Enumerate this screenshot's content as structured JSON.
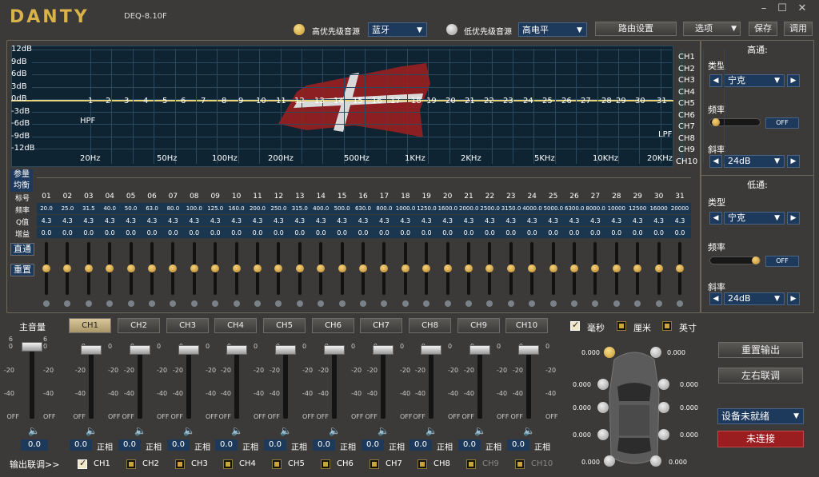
{
  "app": {
    "brand": "DANTY",
    "model": "DEQ-8.10F"
  },
  "window": {
    "min": "–",
    "max": "☐",
    "close": "✕"
  },
  "top": {
    "hi_label": "高优先级音源",
    "hi_value": "蓝牙",
    "lo_label": "低优先级音源",
    "lo_value": "高电平",
    "route_label": "路由设置",
    "options_label": "选项",
    "save_label": "保存",
    "load_label": "调用"
  },
  "graph": {
    "ylabels": [
      "12dB",
      "9dB",
      "6dB",
      "3dB",
      "0dB",
      "-3dB",
      "-6dB",
      "-9dB",
      "-12dB"
    ],
    "flabels": [
      "20Hz",
      "50Hz",
      "100Hz",
      "200Hz",
      "500Hz",
      "1KHz",
      "2KHz",
      "5KHz",
      "10KHz",
      "20KHz"
    ],
    "band_numbers": [
      "1",
      "2",
      "3",
      "4",
      "5",
      "6",
      "7",
      "8",
      "9",
      "10",
      "11",
      "12",
      "13",
      "14",
      "15",
      "16",
      "17",
      "18",
      "19",
      "20",
      "21",
      "22",
      "23",
      "24",
      "25",
      "26",
      "27",
      "28",
      "29",
      "30",
      "31"
    ],
    "hpf": "HPF",
    "lpf": "LPF",
    "channels": [
      "CH1",
      "CH2",
      "CH3",
      "CH4",
      "CH5",
      "CH6",
      "CH7",
      "CH8",
      "CH9",
      "CH10"
    ],
    "colors": {
      "bg": "#0e2433",
      "grid": "#2c4a5e",
      "curve": "#e8d27a"
    }
  },
  "eq": {
    "tab_param": "参量",
    "tab_graphic": "均衡",
    "row_labels": {
      "band": "标号",
      "freq": "频率",
      "q": "Q值",
      "gain": "增益"
    },
    "bypass": "直通",
    "reset": "重置",
    "bands": [
      "01",
      "02",
      "03",
      "04",
      "05",
      "06",
      "07",
      "08",
      "09",
      "10",
      "11",
      "12",
      "13",
      "14",
      "15",
      "16",
      "17",
      "18",
      "19",
      "20",
      "21",
      "22",
      "23",
      "24",
      "25",
      "26",
      "27",
      "28",
      "29",
      "30",
      "31"
    ],
    "freqs": [
      "20.0",
      "25.0",
      "31.5",
      "40.0",
      "50.0",
      "63.0",
      "80.0",
      "100.0",
      "125.0",
      "160.0",
      "200.0",
      "250.0",
      "315.0",
      "400.0",
      "500.0",
      "630.0",
      "800.0",
      "1000.0",
      "1250.0",
      "1600.0",
      "2000.0",
      "2500.0",
      "3150.0",
      "4000.0",
      "5000.0",
      "6300.0",
      "8000.0",
      "10000",
      "12500",
      "16000",
      "20000"
    ],
    "q": [
      "4.3",
      "4.3",
      "4.3",
      "4.3",
      "4.3",
      "4.3",
      "4.3",
      "4.3",
      "4.3",
      "4.3",
      "4.3",
      "4.3",
      "4.3",
      "4.3",
      "4.3",
      "4.3",
      "4.3",
      "4.3",
      "4.3",
      "4.3",
      "4.3",
      "4.3",
      "4.3",
      "4.3",
      "4.3",
      "4.3",
      "4.3",
      "4.3",
      "4.3",
      "4.3",
      "4.3"
    ],
    "gain": [
      "0.0",
      "0.0",
      "0.0",
      "0.0",
      "0.0",
      "0.0",
      "0.0",
      "0.0",
      "0.0",
      "0.0",
      "0.0",
      "0.0",
      "0.0",
      "0.0",
      "0.0",
      "0.0",
      "0.0",
      "0.0",
      "0.0",
      "0.0",
      "0.0",
      "0.0",
      "0.0",
      "0.0",
      "0.0",
      "0.0",
      "0.0",
      "0.0",
      "0.0",
      "0.0",
      "0.0"
    ]
  },
  "highpass": {
    "title": "高通:",
    "type_label": "类型",
    "type_value": "宁克",
    "freq_label": "频率",
    "freq_btn": "OFF",
    "slope_label": "斜率",
    "slope_value": "24dB",
    "freq_level": 0
  },
  "lowpass": {
    "title": "低通:",
    "type_label": "类型",
    "type_value": "宁克",
    "freq_label": "频率",
    "freq_btn": "OFF",
    "slope_label": "斜率",
    "slope_value": "24dB",
    "freq_level": 1
  },
  "master": {
    "label": "主音量",
    "top_left": "6",
    "top_right": "6",
    "t0": "0",
    "t20": "-20",
    "t40": "-40",
    "off": "OFF",
    "value": "0.0"
  },
  "channels": {
    "tabs": [
      "CH1",
      "CH2",
      "CH3",
      "CH4",
      "CH5",
      "CH6",
      "CH7",
      "CH8",
      "CH9",
      "CH10"
    ],
    "ticks": [
      "0",
      "-20",
      "-40",
      "OFF"
    ],
    "values": [
      "0.0",
      "0.0",
      "0.0",
      "0.0",
      "0.0",
      "0.0",
      "0.0",
      "0.0",
      "0.0",
      "0.0"
    ],
    "phase": "正相",
    "link_label": "输出联调>>",
    "link_checks": [
      "CH1",
      "CH2",
      "CH3",
      "CH4",
      "CH5",
      "CH6",
      "CH7",
      "CH8",
      "CH9",
      "CH10"
    ]
  },
  "units": {
    "ms": "毫秒",
    "cm": "厘米",
    "inch": "英寸"
  },
  "delay": {
    "values": [
      "0.000",
      "0.000",
      "0.000",
      "0.000",
      "0.000",
      "0.000",
      "0.000",
      "0.000",
      "0.000",
      "0.000"
    ]
  },
  "right_buttons": {
    "reset_out": "重置输出",
    "lr_link": "左右联调",
    "device": "设备未就绪",
    "conn": "未连接"
  }
}
